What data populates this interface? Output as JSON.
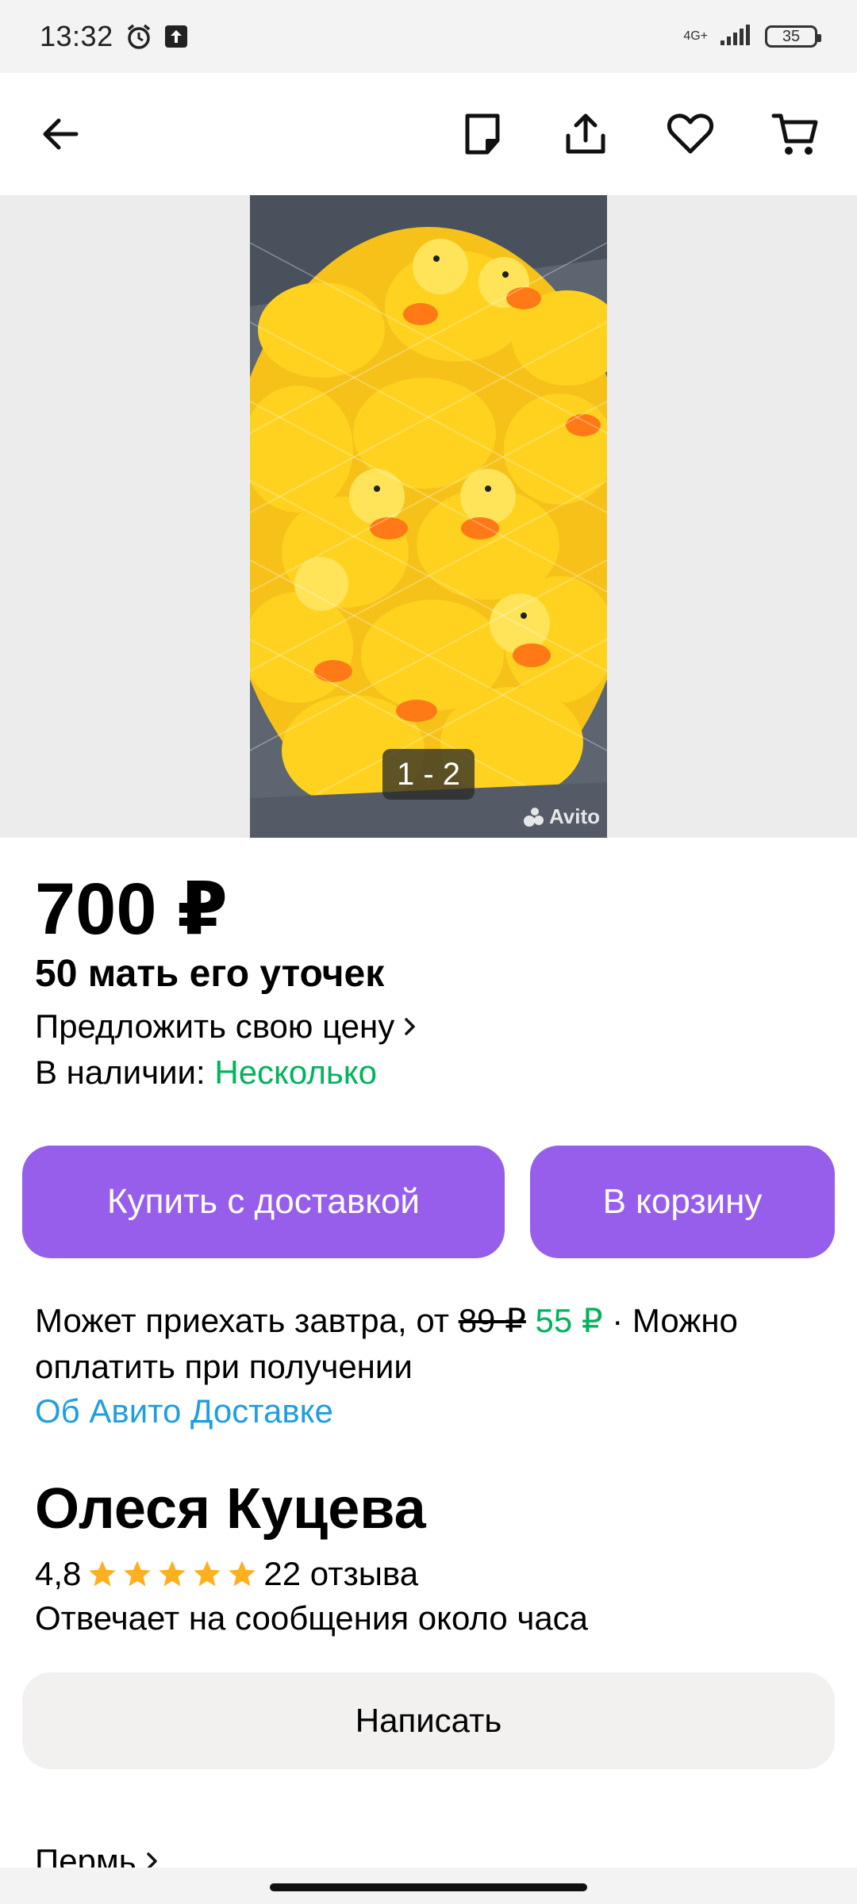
{
  "status_bar": {
    "time": "13:32",
    "network": "4G+",
    "battery": "35"
  },
  "toolbar": {
    "back_icon": "arrow-left-icon",
    "icons": [
      "note-icon",
      "share-icon",
      "heart-icon",
      "cart-icon"
    ]
  },
  "gallery": {
    "counter": "1 - 2",
    "watermark": "Avito"
  },
  "listing": {
    "price": "700 ₽",
    "title": "50 мать его уточек",
    "offer_price_label": "Предложить свою цену",
    "availability_label": "В наличии:",
    "availability_value": "Несколько"
  },
  "actions": {
    "buy_delivery": "Купить с доставкой",
    "add_to_cart": "В корзину"
  },
  "delivery": {
    "text_before": "Может приехать завтра, от",
    "old_price": "89 ₽",
    "new_price": "55 ₽",
    "text_after": "· Можно оплатить при получении",
    "link": "Об Авито Доставке"
  },
  "seller": {
    "name": "Олеся Куцева",
    "rating": "4,8",
    "stars": 5,
    "reviews": "22 отзыва",
    "reply_time": "Отвечает на сообщения около часа",
    "write_button": "Написать",
    "city": "Пермь"
  },
  "colors": {
    "accent_purple": "#965eeb",
    "green": "#02b35d",
    "link_blue": "#1f9ee0",
    "star": "#ffb021"
  }
}
